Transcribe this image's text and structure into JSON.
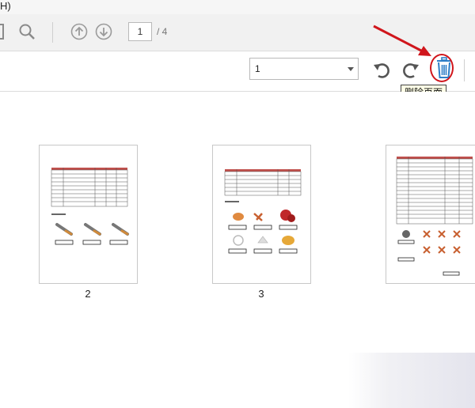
{
  "menubar": {
    "fragment": "H)"
  },
  "toolbar": {
    "page_number": "1",
    "page_total": "/ 4",
    "icons": [
      "page-icon",
      "search-icon",
      "arrow-up-icon",
      "arrow-down-icon"
    ]
  },
  "toolbar2": {
    "select_value": "1",
    "icons": [
      "rotate-left-icon",
      "rotate-right-icon",
      "trash-icon"
    ],
    "highlight_color": "#d0161c",
    "tooltip": "删除页面"
  },
  "thumbnails": [
    {
      "label": "2"
    },
    {
      "label": "3"
    },
    {
      "label": ""
    }
  ],
  "annotation": {
    "arrow_color": "#d0161c"
  }
}
